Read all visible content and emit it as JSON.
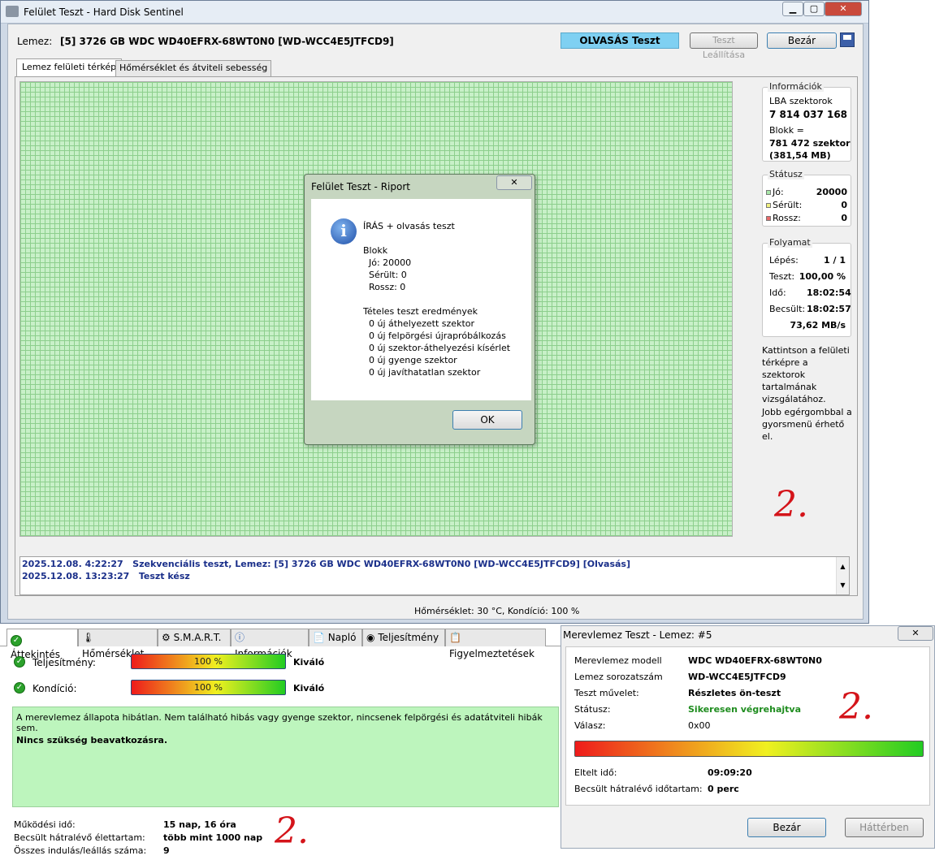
{
  "main_window": {
    "title": "Felület Teszt - Hard Disk Sentinel",
    "disk_label": "Lemez:",
    "disk_value": "[5] 3726 GB  WDC WD40EFRX-68WT0N0 [WD-WCC4E5JTFCD9]",
    "mode": "OLVASÁS Teszt",
    "stop_button": "Teszt Leállítása",
    "close_button": "Bezár",
    "tabs": [
      "Lemez felületi térkép",
      "Hőmérséklet és átviteli sebesség"
    ],
    "info": {
      "header": "Információk",
      "lba_label": "LBA szektorok",
      "lba_value": "7 814 037 168",
      "block_label": "Blokk =",
      "block_value": "781 472 szektor",
      "block_size": "(381,54 MB)"
    },
    "status": {
      "header": "Státusz",
      "good_label": "Jó:",
      "good": "20000",
      "damaged_label": "Sérült:",
      "damaged": "0",
      "bad_label": "Rossz:",
      "bad": "0"
    },
    "progress": {
      "header": "Folyamat",
      "step_label": "Lépés:",
      "step": "1 / 1",
      "test_label": "Teszt:",
      "test": "100,00 %",
      "time_label": "Idő:",
      "time": "18:02:54",
      "est_label": "Becsült:",
      "est": "18:02:57",
      "speed": "73,62 MB/s"
    },
    "hint1": "Kattintson a felületi térképre a szektorok tartalmának vizsgálatához.",
    "hint2": "Jobb egérgombbal a gyorsmenü érhető el.",
    "log": [
      {
        "time": "2025.12.08.  4:22:27",
        "text": "Szekvenciális teszt, Lemez: [5] 3726 GB  WDC WD40EFRX-68WT0N0 [WD-WCC4E5JTFCD9] [Olvasás]"
      },
      {
        "time": "2025.12.08.  13:23:27",
        "text": "Teszt kész"
      }
    ],
    "statusbar": "Hőmérséklet: 30  °C,  Kondíció: 100 %",
    "annotation": "2."
  },
  "report_dialog": {
    "title": "Felület Teszt - Riport",
    "lines": [
      "ÍRÁS + olvasás teszt",
      "",
      "Blokk",
      "  Jó: 20000",
      "  Sérült: 0",
      "  Rossz: 0",
      "",
      "Tételes teszt eredmények",
      "  0 új áthelyezett szektor",
      "  0 új felpörgési újrapróbálkozás",
      "  0 új szektor-áthelyezési kísérlet",
      "  0 új gyenge szektor",
      "  0 új javíthatatlan szektor"
    ],
    "ok": "OK"
  },
  "overview": {
    "tabs": [
      "Áttekintés",
      "Hőmérséklet",
      "S.M.A.R.T.",
      "Információk",
      "Napló",
      "Teljesítmény",
      "Figyelmeztetések"
    ],
    "perf_label": "Teljesítmény:",
    "perf_value": "100 %",
    "perf_percent": 100,
    "perf_rating": "Kiváló",
    "cond_label": "Kondíció:",
    "cond_value": "100 %",
    "cond_percent": 100,
    "cond_rating": "Kiváló",
    "message": "A merevlemez állapota hibátlan. Nem található hibás vagy gyenge szektor, nincsenek felpörgési és adatátviteli hibák sem.",
    "message_bold": "Nincs szükség beavatkozásra.",
    "uptime_label": "Működési idő:",
    "uptime": "15 nap, 16 óra",
    "life_label": "Becsült hátralévő élettartam:",
    "life": "több mint 1000 nap",
    "starts_label": "Összes indulás/leállás száma:",
    "starts": "9",
    "annotation": "2."
  },
  "disk_test_dialog": {
    "title": "Merevlemez Teszt - Lemez: #5",
    "rows": [
      {
        "label": "Merevlemez modell",
        "value": "WDC WD40EFRX-68WT0N0"
      },
      {
        "label": "Lemez sorozatszám",
        "value": "WD-WCC4E5JTFCD9"
      },
      {
        "label": "Teszt művelet:",
        "value": "Részletes ön-teszt"
      },
      {
        "label": "Státusz:",
        "value": "Sikeresen végrehajtva"
      },
      {
        "label": "Válasz:",
        "value": "0x00"
      }
    ],
    "progress_percent": 100,
    "elapsed_label": "Eltelt idő:",
    "elapsed": "09:09:20",
    "remaining_label": "Becsült hátralévő időtartam:",
    "remaining": "0 perc",
    "close": "Bezár",
    "background": "Háttérben",
    "annotation": "2.",
    "status_color": "#1e8c1e"
  }
}
